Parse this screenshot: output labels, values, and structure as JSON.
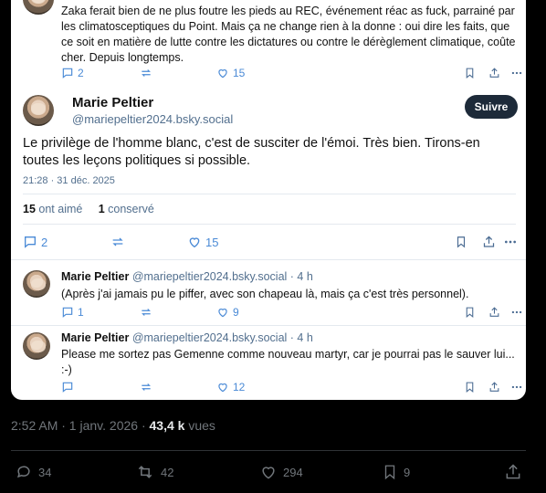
{
  "previous_post": {
    "text": "Zaka ferait bien de ne plus foutre les pieds au REC, événement réac as fuck, parrainé par les climatosceptiques du Point. Mais ça ne change rien à la donne : oui dire les faits, que ce soit en matière de lutte contre les dictatures ou contre le dérèglement climatique, coûte cher. Depuis longtemps.",
    "replies": "2",
    "likes": "15"
  },
  "main_post": {
    "author_name": "Marie Peltier",
    "author_handle": "@mariepeltier2024.bsky.social",
    "follow_label": "Suivre",
    "text": "Le privilège de l'homme blanc, c'est de susciter de l'émoi. Très bien. Tirons-en toutes les leçons politiques si possible.",
    "timestamp": "21:28 · 31 déc. 2025",
    "likes_count": "15",
    "likes_label": "ont aimé",
    "saves_count": "1",
    "saves_label": "conservé",
    "replies": "2",
    "likes": "15"
  },
  "replies": [
    {
      "author_name": "Marie Peltier",
      "meta": "@mariepeltier2024.bsky.social · 4 h",
      "text": "(Après j'ai jamais pu le piffer, avec son chapeau là, mais ça c'est très personnel).",
      "replies": "1",
      "likes": "9"
    },
    {
      "author_name": "Marie Peltier",
      "meta": "@mariepeltier2024.bsky.social · 4 h",
      "text": "Please me sortez pas Gemenne comme nouveau martyr, car je pourrai pas le sauver lui... :-)",
      "replies": "",
      "likes": "12"
    }
  ],
  "x_post": {
    "time": "2:52 AM · 1 janv. 2026 · ",
    "views_count": "43,4 k",
    "views_label": " vues",
    "replies": "34",
    "reposts": "42",
    "likes": "294",
    "bookmarks": "9"
  }
}
